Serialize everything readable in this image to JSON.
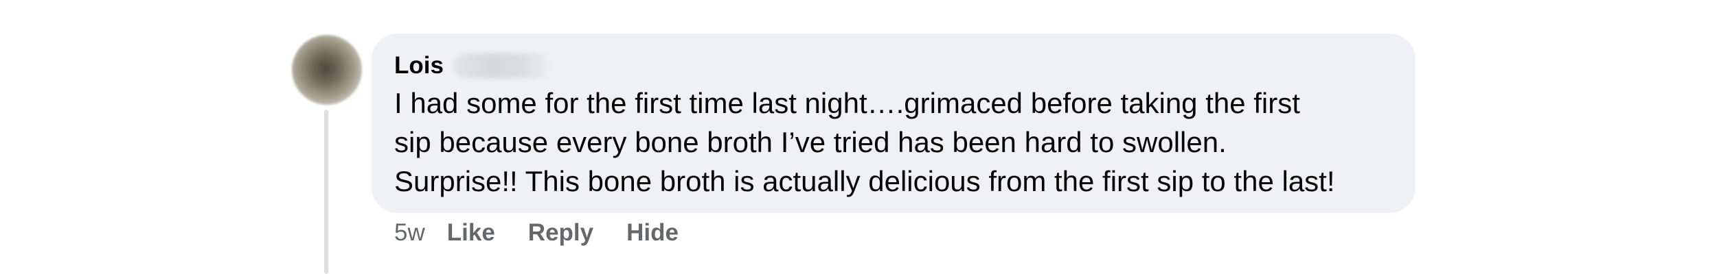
{
  "comment": {
    "author": "Lois",
    "lines": [
      "I had some for the first time last night….grimaced before taking the first",
      "sip because every bone broth I’ve tried has been hard to swollen.",
      "Surprise!! This bone broth is actually delicious from the first sip to the last!"
    ],
    "time": "5w",
    "actions": {
      "like": "Like",
      "reply": "Reply",
      "hide": "Hide"
    }
  }
}
